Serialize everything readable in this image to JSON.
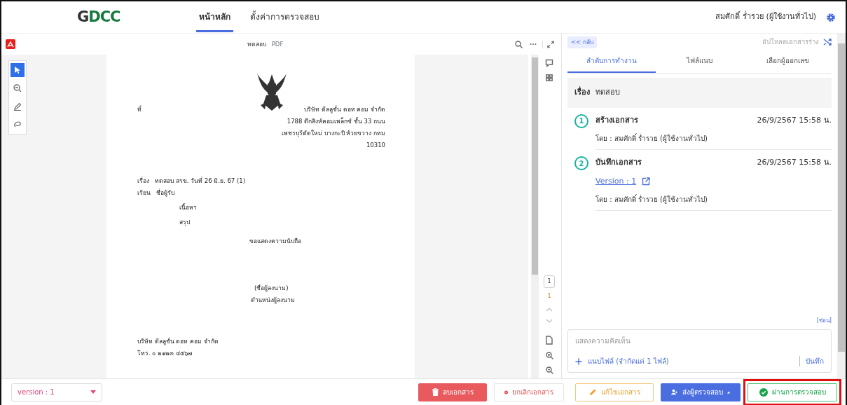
{
  "header": {
    "logo": "GDCC",
    "nav": [
      {
        "label": "หน้าหลัก",
        "selected": true
      },
      {
        "label": "ตั้งค่าการตรวจสอบ",
        "selected": false
      }
    ],
    "user": "สมศักดิ์ ร่ำรวย (ผู้ใช้งานทั่วไป)"
  },
  "viewer": {
    "title": "ทดสอบ",
    "file_type": "PDF",
    "tools": [
      {
        "kind": "pointer",
        "selected": true
      },
      {
        "kind": "zoom",
        "selected": false
      },
      {
        "kind": "pen",
        "selected": false
      },
      {
        "kind": "lasso",
        "selected": false
      }
    ],
    "page_input": "1",
    "page_current": "1"
  },
  "document": {
    "ref_label": "ที่",
    "address": [
      "บริษัท ดีลลูชั่น ดอท คอม จำกัด",
      "1788 ตึกสิงห์คอมเพล็กซ์ ชั้น 33 ถนน",
      "เพชรบุรีตัดใหม่ บางกะปิ ห้วยขวาง กทม",
      "10310"
    ],
    "subject_label": "เรื่อง",
    "subject": "ทดสอบ สรข. วันที่ 26 มิ.ย. 67 (1)",
    "to_label": "เรียน",
    "to": "ชื่อผู้รับ",
    "body": [
      "เนื้อหา",
      "สรุป"
    ],
    "closing": "ขอแสดงความนับถือ",
    "signer": "(ชื่อผู้ลงนาม)",
    "signer_position": "ตำแหน่งผู้ลงนาม",
    "footer": [
      "บริษัท ดีลลูชั่น ดอท คอม จำกัด",
      "โทร. ๐ ๒๑๒๓ ๔๕๖๗"
    ]
  },
  "panel": {
    "back": "<< กลับ",
    "upload": "อัปโหลดเอกสารร่าง",
    "tabs": [
      {
        "label": "ลำดับการทำงาน",
        "selected": true
      },
      {
        "label": "ไฟล์แนบ",
        "selected": false
      },
      {
        "label": "เลือกผู้ออกเลข",
        "selected": false
      }
    ],
    "subject_label": "เรื่อง",
    "subject": "ทดสอบ",
    "steps": [
      {
        "number": "1",
        "title": "สร้างเอกสาร",
        "time": "26/9/2567 15:58 น.",
        "by": "โดย : สมศักดิ์ ร่ำรวย (ผู้ใช้งานทั่วไป)"
      },
      {
        "number": "2",
        "title": "บันทึกเอกสาร",
        "time": "26/9/2567 15:58 น.",
        "link": "Version : 1",
        "by": "โดย : สมศักดิ์ ร่ำรวย (ผู้ใช้งานทั่วไป)"
      }
    ],
    "hide": "[ซ่อน]",
    "comment": {
      "placeholder": "แสดงความคิดเห็น",
      "attach": "แนบไฟล์ (จำกัดแค่ 1 ไฟล์)",
      "save": "บันทึก"
    }
  },
  "footer": {
    "version_select": "version : 1",
    "buttons": [
      {
        "kind": "delete",
        "label": "ลบเอกสาร",
        "highlighted": false
      },
      {
        "kind": "cancel",
        "label": "ยกเลิกเอกสาร",
        "highlighted": false
      },
      {
        "kind": "edit",
        "label": "แก้ไขเอกสาร",
        "highlighted": false
      },
      {
        "kind": "send",
        "label": "ส่งผู้ตรวจสอบ",
        "highlighted": false
      },
      {
        "kind": "approve",
        "label": "ผ่านการตรวจสอบ",
        "highlighted": true
      }
    ]
  }
}
